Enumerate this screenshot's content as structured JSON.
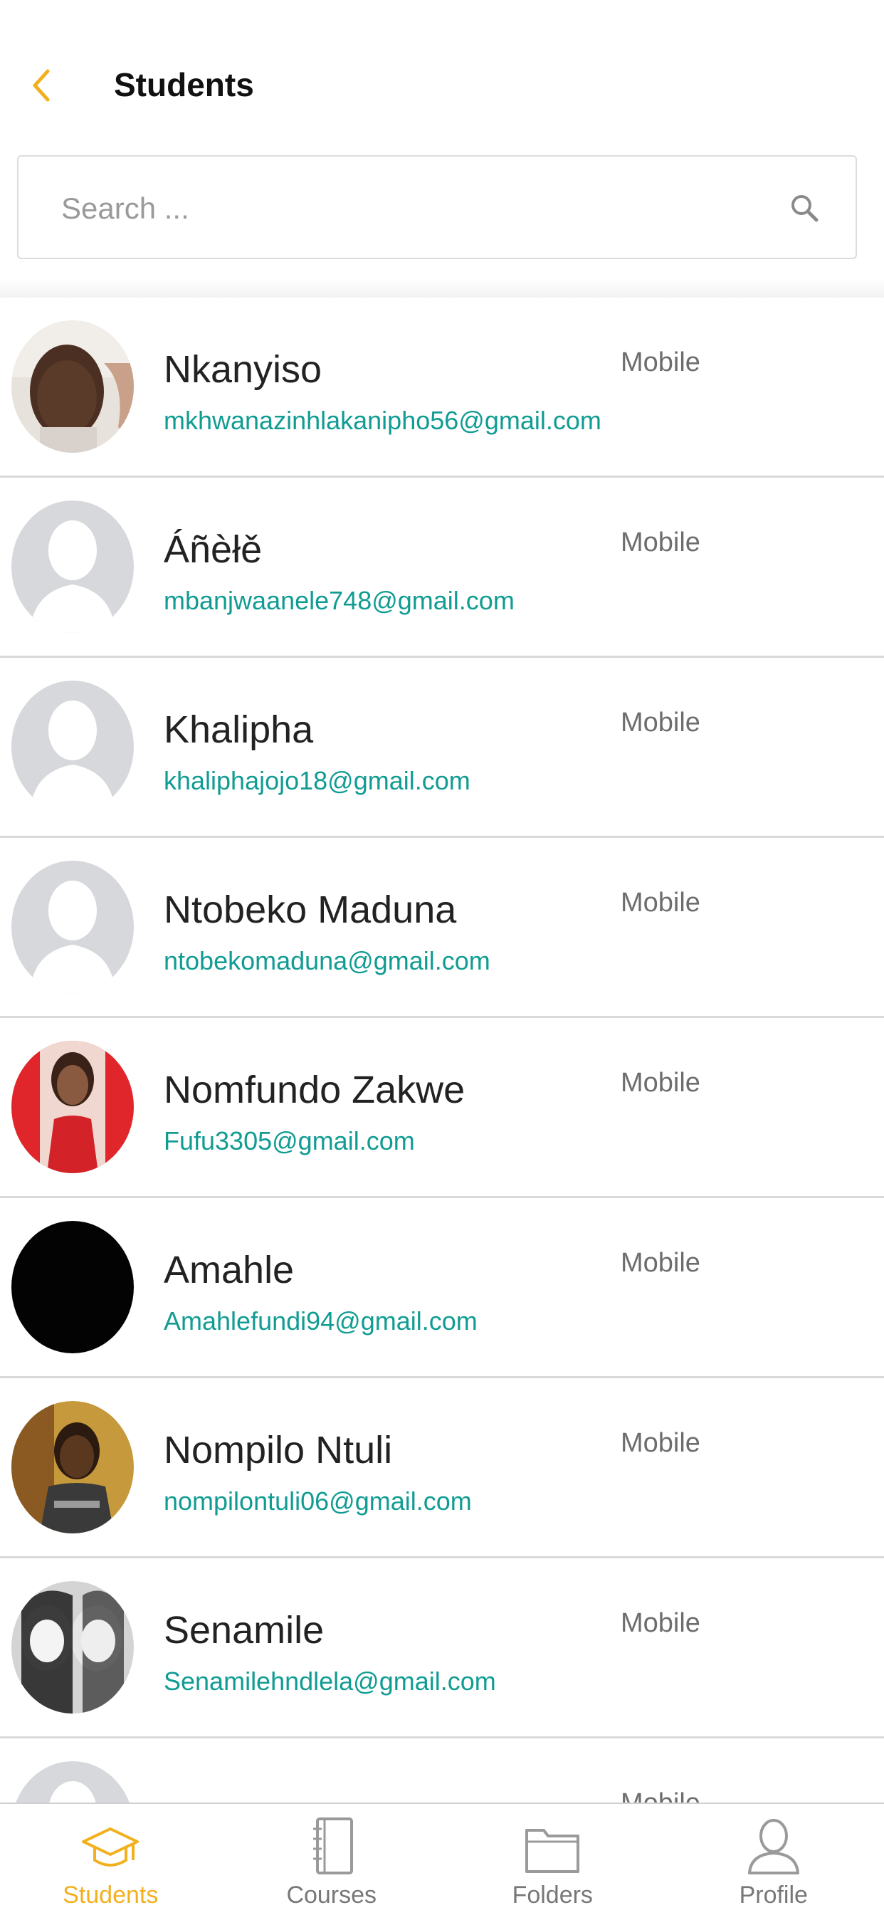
{
  "header": {
    "title": "Students",
    "back_icon": "chevron-left-icon"
  },
  "search": {
    "placeholder": "Search ...",
    "value": "",
    "icon": "search-icon"
  },
  "colors": {
    "accent": "#f2b01e",
    "email": "#119c93",
    "divider": "#d9d9d9"
  },
  "students": [
    {
      "name": "Nkanyiso",
      "email": "mkhwanazinhlakanipho56@gmail.com",
      "platform": "Mobile",
      "avatar": "photo"
    },
    {
      "name": "Áñèłě",
      "email": "mbanjwaanele748@gmail.com",
      "platform": "Mobile",
      "avatar": "placeholder"
    },
    {
      "name": "Khalipha",
      "email": "khaliphajojo18@gmail.com",
      "platform": "Mobile",
      "avatar": "placeholder"
    },
    {
      "name": "Ntobeko Maduna",
      "email": "ntobekomaduna@gmail.com",
      "platform": "Mobile",
      "avatar": "placeholder"
    },
    {
      "name": "Nomfundo Zakwe",
      "email": "Fufu3305@gmail.com",
      "platform": "Mobile",
      "avatar": "photo"
    },
    {
      "name": "Amahle",
      "email": "Amahlefundi94@gmail.com",
      "platform": "Mobile",
      "avatar": "photo"
    },
    {
      "name": "Nompilo Ntuli",
      "email": "nompilontuli06@gmail.com",
      "platform": "Mobile",
      "avatar": "photo"
    },
    {
      "name": "Senamile",
      "email": "Senamilehndlela@gmail.com",
      "platform": "Mobile",
      "avatar": "photo"
    },
    {
      "name": "",
      "email": "",
      "platform": "Mobile",
      "avatar": "placeholder"
    }
  ],
  "nav": [
    {
      "label": "Students",
      "icon": "graduation-cap-icon",
      "active": true
    },
    {
      "label": "Courses",
      "icon": "notebook-icon",
      "active": false
    },
    {
      "label": "Folders",
      "icon": "folder-icon",
      "active": false
    },
    {
      "label": "Profile",
      "icon": "user-icon",
      "active": false
    }
  ]
}
